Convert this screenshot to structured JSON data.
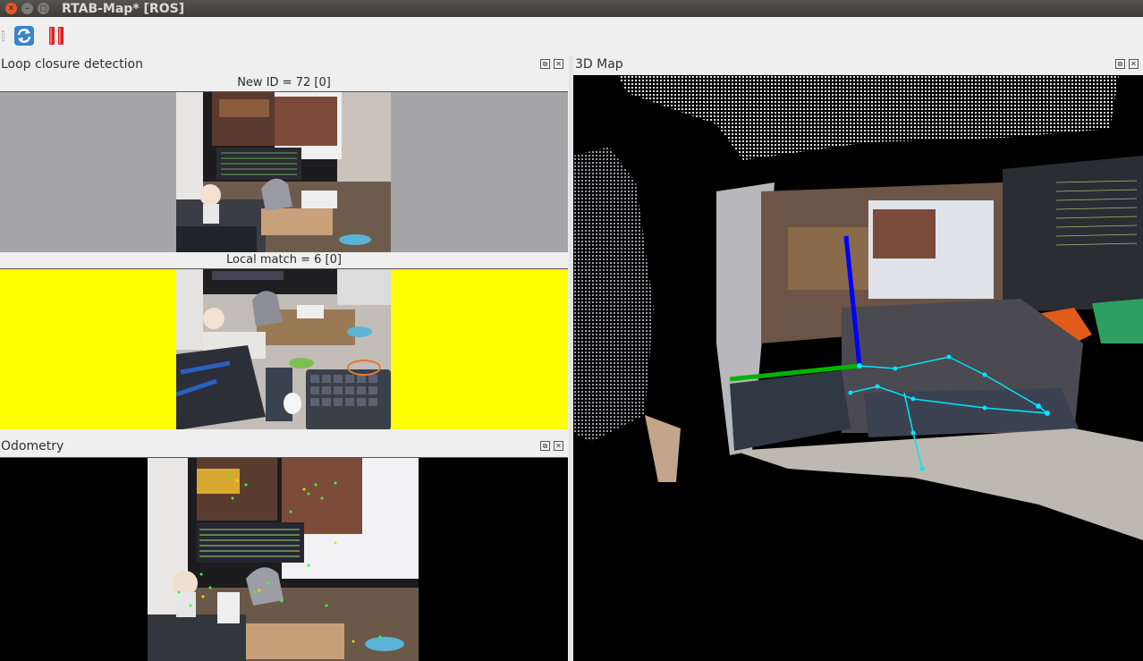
{
  "window": {
    "title": "RTAB-Map* [ROS]"
  },
  "toolbar": {
    "refresh_tip": "refresh",
    "pause_tip": "pause"
  },
  "loop": {
    "title": "Loop closure detection",
    "new_id": "New ID = 72 [0]",
    "local_match": "Local match = 6 [0]"
  },
  "odometry": {
    "title": "Odometry"
  },
  "map3d": {
    "title": "3D Map"
  },
  "colors": {
    "titlebar": "#3d3c38",
    "close": "#e8572c",
    "loop_bg": "#a6a6a8",
    "local_bg": "#ffff00",
    "map_bg": "#000000",
    "axis_x": "#00b400",
    "axis_z": "#0000ff",
    "trajectory": "#00e5ff"
  },
  "icons": [
    "refresh-icon",
    "pause-icon",
    "float-icon",
    "close-icon"
  ]
}
